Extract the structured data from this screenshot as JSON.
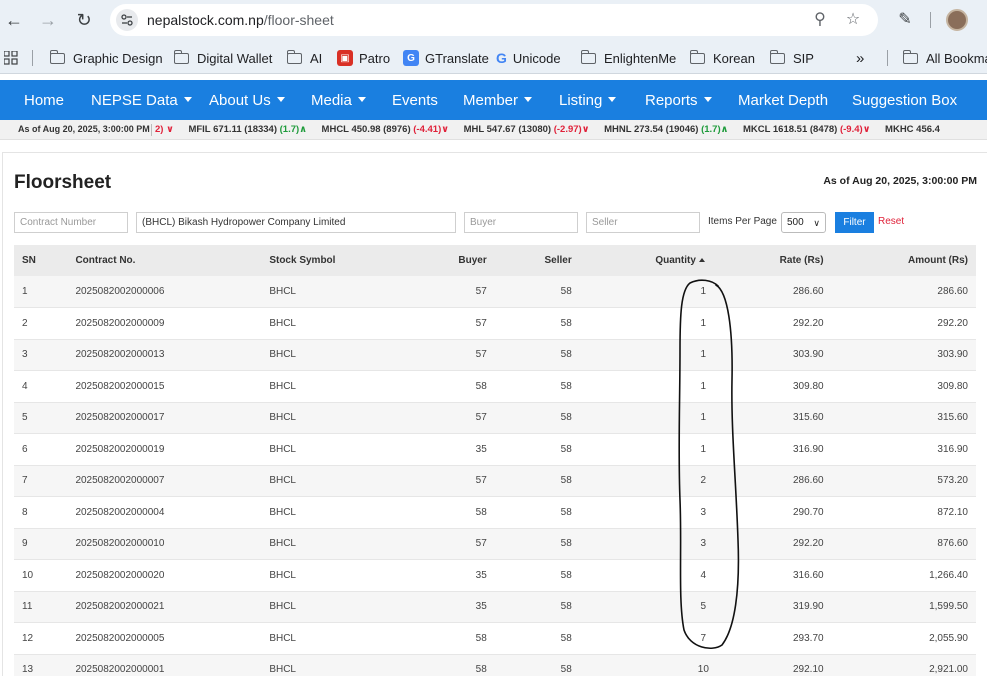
{
  "browser": {
    "url_host": "nepalstock.com.np",
    "url_path": "/floor-sheet",
    "bookmarks": [
      {
        "label": "Graphic Design",
        "icon": "folder-icon"
      },
      {
        "label": "Digital Wallet",
        "icon": "folder-icon"
      },
      {
        "label": "AI",
        "icon": "folder-icon"
      },
      {
        "label": "Patro",
        "icon": "patro-icon",
        "color": "#d93025"
      },
      {
        "label": "GTranslate",
        "icon": "translate-icon",
        "color": "#4285f4"
      },
      {
        "label": "Unicode",
        "icon": "google-icon"
      },
      {
        "label": "EnlightenMe",
        "icon": "folder-icon"
      },
      {
        "label": "Korean",
        "icon": "folder-icon"
      },
      {
        "label": "SIP",
        "icon": "folder-icon"
      }
    ],
    "more_bookmarks": "»",
    "all_bookmarks": "All Bookma"
  },
  "nav": {
    "items": [
      {
        "label": "Home",
        "dropdown": false
      },
      {
        "label": "NEPSE Data",
        "dropdown": true
      },
      {
        "label": "About Us",
        "dropdown": true
      },
      {
        "label": "Media",
        "dropdown": true
      },
      {
        "label": "Events",
        "dropdown": false
      },
      {
        "label": "Member",
        "dropdown": true
      },
      {
        "label": "Listing",
        "dropdown": true
      },
      {
        "label": "Reports",
        "dropdown": true
      },
      {
        "label": "Market Depth",
        "dropdown": false
      },
      {
        "label": "Suggestion Box",
        "dropdown": false
      }
    ],
    "bar_color": "#1a7fe0"
  },
  "ticker": {
    "date": "As of Aug 20, 2025, 3:00:00 PM",
    "items": [
      {
        "text": "",
        "change": "2)",
        "dir": "down"
      },
      {
        "text": "MFIL 671.11 (18334)",
        "change": "(1.7)",
        "dir": "up"
      },
      {
        "text": "MHCL 450.98 (8976)",
        "change": "(-4.41)",
        "dir": "down"
      },
      {
        "text": "MHL 547.67 (13080)",
        "change": "(-2.97)",
        "dir": "down"
      },
      {
        "text": "MHNL 273.54 (19046)",
        "change": "(1.7)",
        "dir": "up"
      },
      {
        "text": "MKCL 1618.51 (8478)",
        "change": "(-9.4)",
        "dir": "down"
      },
      {
        "text": "MKHC 456.4",
        "change": "",
        "dir": "none"
      }
    ]
  },
  "floorsheet": {
    "title": "Floorsheet",
    "as_of": "As of Aug 20, 2025, 3:00:00 PM",
    "filters": {
      "contract_placeholder": "Contract Number",
      "stock_value": "(BHCL) Bikash Hydropower Company Limited",
      "buyer_placeholder": "Buyer",
      "seller_placeholder": "Seller",
      "items_per_page_label": "Items Per Page",
      "items_per_page_value": "500",
      "filter_label": "Filter",
      "reset_label": "Reset"
    },
    "columns": [
      "SN",
      "Contract No.",
      "Stock Symbol",
      "Buyer",
      "Seller",
      "Quantity",
      "Rate (Rs)",
      "Amount (Rs)"
    ],
    "rows": [
      [
        "1",
        "2025082002000006",
        "BHCL",
        "57",
        "58",
        "1",
        "286.60",
        "286.60"
      ],
      [
        "2",
        "2025082002000009",
        "BHCL",
        "57",
        "58",
        "1",
        "292.20",
        "292.20"
      ],
      [
        "3",
        "2025082002000013",
        "BHCL",
        "57",
        "58",
        "1",
        "303.90",
        "303.90"
      ],
      [
        "4",
        "2025082002000015",
        "BHCL",
        "58",
        "58",
        "1",
        "309.80",
        "309.80"
      ],
      [
        "5",
        "2025082002000017",
        "BHCL",
        "57",
        "58",
        "1",
        "315.60",
        "315.60"
      ],
      [
        "6",
        "2025082002000019",
        "BHCL",
        "35",
        "58",
        "1",
        "316.90",
        "316.90"
      ],
      [
        "7",
        "2025082002000007",
        "BHCL",
        "57",
        "58",
        "2",
        "286.60",
        "573.20"
      ],
      [
        "8",
        "2025082002000004",
        "BHCL",
        "58",
        "58",
        "3",
        "290.70",
        "872.10"
      ],
      [
        "9",
        "2025082002000010",
        "BHCL",
        "57",
        "58",
        "3",
        "292.20",
        "876.60"
      ],
      [
        "10",
        "2025082002000020",
        "BHCL",
        "35",
        "58",
        "4",
        "316.60",
        "1,266.40"
      ],
      [
        "11",
        "2025082002000021",
        "BHCL",
        "35",
        "58",
        "5",
        "319.90",
        "1,599.50"
      ],
      [
        "12",
        "2025082002000005",
        "BHCL",
        "58",
        "58",
        "7",
        "293.70",
        "2,055.90"
      ],
      [
        "13",
        "2025082002000001",
        "BHCL",
        "58",
        "58",
        "10",
        "292.10",
        "2,921.00"
      ]
    ]
  }
}
